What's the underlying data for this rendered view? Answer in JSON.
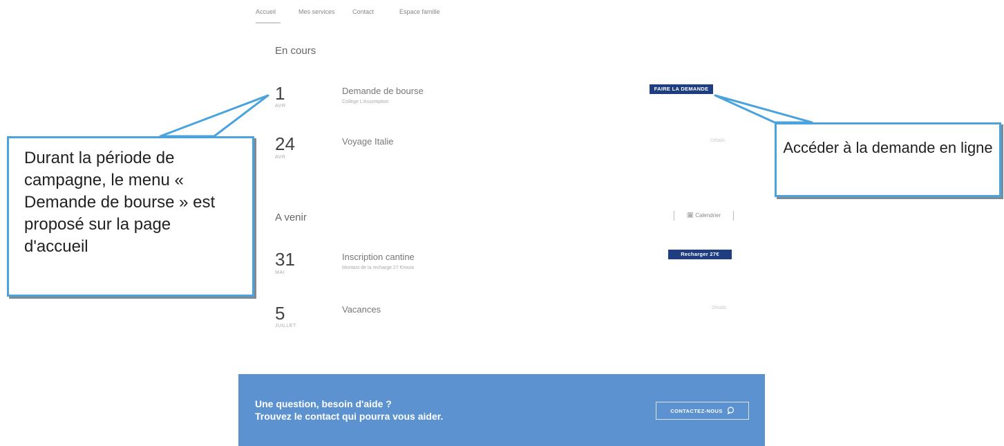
{
  "nav": {
    "items": [
      "Accueil",
      "Mes services",
      "Contact",
      "Espace famille"
    ]
  },
  "current": {
    "title": "En cours",
    "events": [
      {
        "day": "1",
        "month": "AVR",
        "title": "Demande de bourse",
        "subtitle": "Collège L'Assomption",
        "action": "FAIRE LA DEMANDE"
      },
      {
        "day": "24",
        "month": "AVR",
        "title": "Voyage Italie",
        "subtitle": "",
        "action": "Détails"
      }
    ]
  },
  "upcoming": {
    "title": "A venir",
    "calendar_label": "Calendrier",
    "events": [
      {
        "day": "31",
        "month": "MAI",
        "title": "Inscription cantine",
        "subtitle": "Montant de la recharge 27 €/mois",
        "action": "Recharger 27€"
      },
      {
        "day": "5",
        "month": "JUILLET",
        "title": "Vacances",
        "subtitle": "",
        "action": "Détails"
      }
    ]
  },
  "help": {
    "line1": "Une question, besoin d'aide ?",
    "line2": "Trouvez le contact qui pourra vous aider.",
    "button": "CONTACTEZ-NOUS"
  },
  "annotations": {
    "left": "Durant la période de campagne, le menu « Demande de bourse » est proposé sur la page d'accueil",
    "right": "Accéder à la demande en ligne"
  },
  "colors": {
    "primary_button": "#1f3e82",
    "help_banner": "#5b92cf",
    "callout_border": "#4aa3dd"
  }
}
